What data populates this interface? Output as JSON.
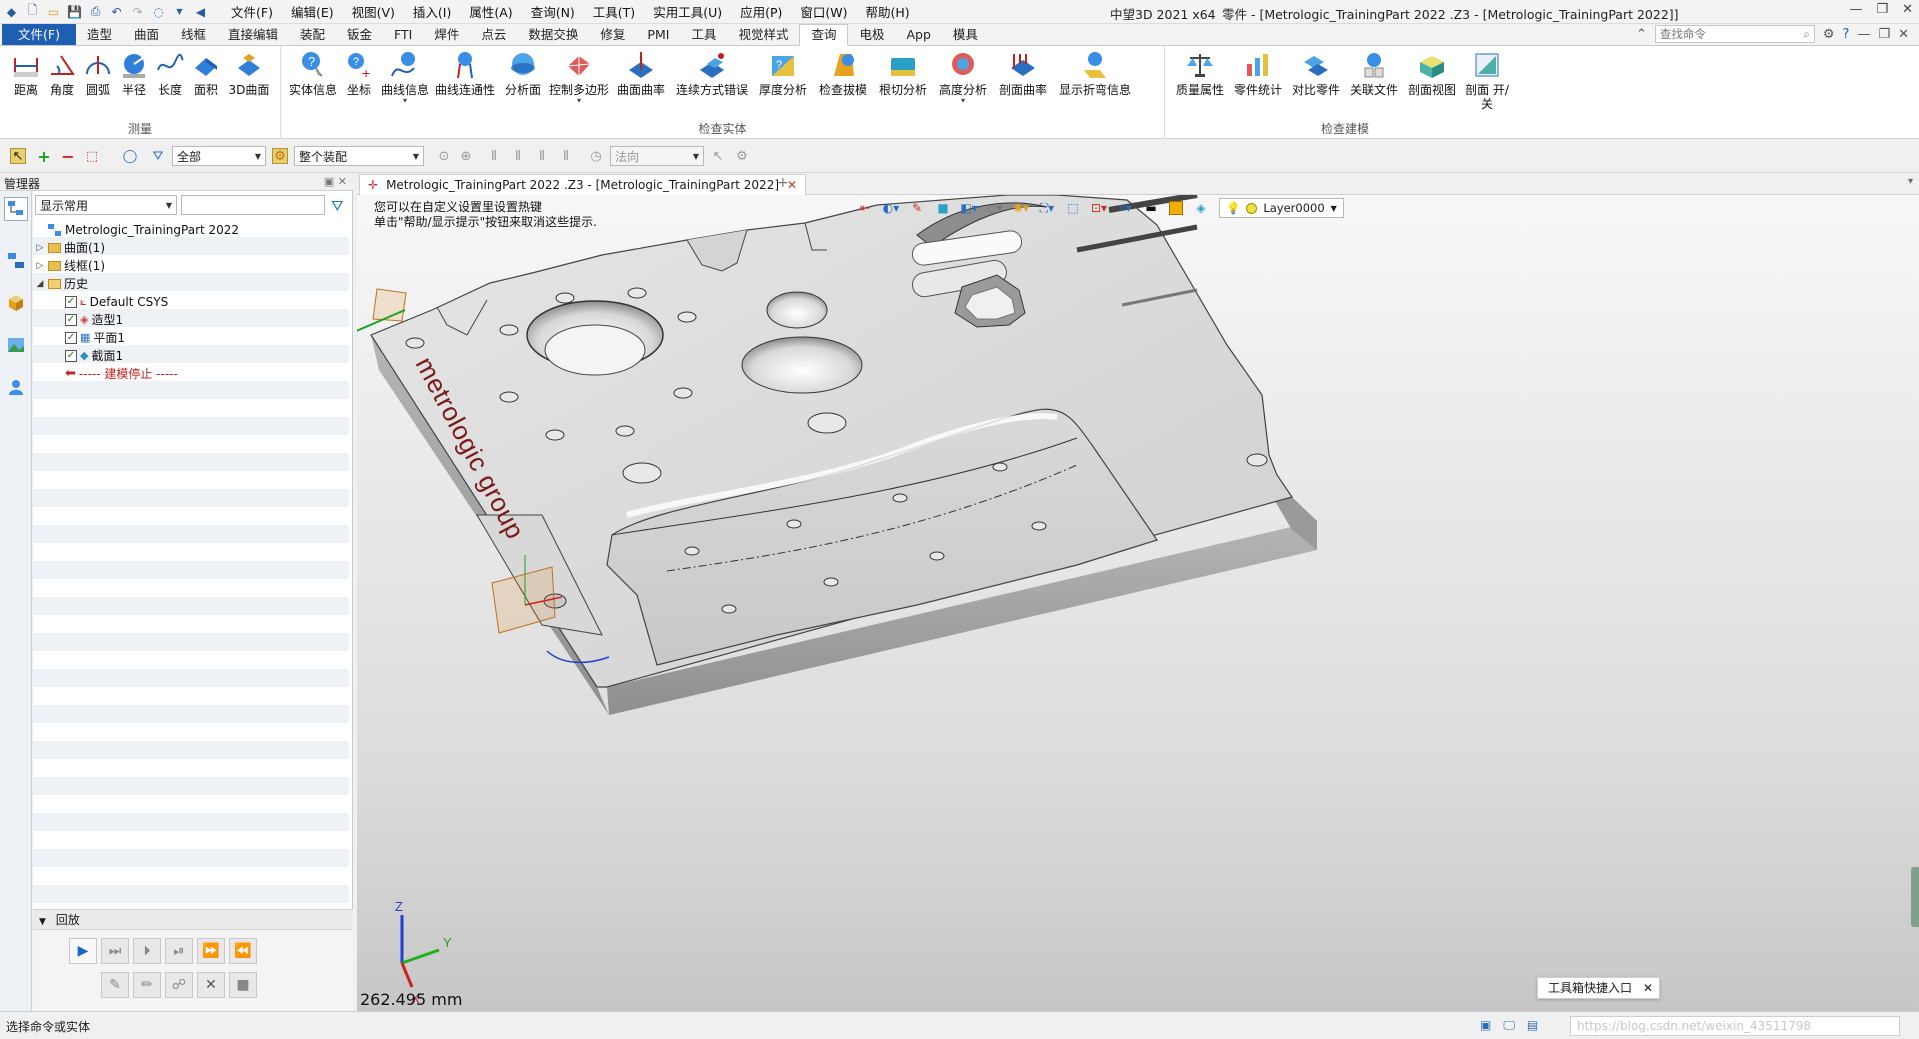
{
  "titlebar": {
    "menus": [
      "文件(F)",
      "编辑(E)",
      "视图(V)",
      "插入(I)",
      "属性(A)",
      "查询(N)",
      "工具(T)",
      "实用工具(U)",
      "应用(P)",
      "窗口(W)",
      "帮助(H)"
    ],
    "app_name": "中望3D 2021 x64",
    "doc_title": "零件 - [Metrologic_TrainingPart  2022 .Z3 - [Metrologic_TrainingPart  2022]]"
  },
  "ribbon_tabs": [
    "文件(F)",
    "造型",
    "曲面",
    "线框",
    "直接编辑",
    "装配",
    "钣金",
    "FTI",
    "焊件",
    "点云",
    "数据交换",
    "修复",
    "PMI",
    "工具",
    "视觉样式",
    "查询",
    "电极",
    "App",
    "模具"
  ],
  "active_tab": "查询",
  "command_search": {
    "placeholder": "查找命令"
  },
  "ribbon": {
    "measure": {
      "name": "测量",
      "buttons": [
        "距离",
        "角度",
        "圆弧",
        "半径",
        "长度",
        "面积",
        "3D曲面"
      ]
    },
    "inspect_entity": {
      "name": "检查实体",
      "buttons": [
        "实体信息",
        "坐标",
        "曲线信息",
        "曲线连通性",
        "分析面",
        "控制多边形",
        "曲面曲率",
        "连续方式错误",
        "厚度分析",
        "检查拔模",
        "根切分析",
        "高度分析",
        "剖面曲率",
        "显示折弯信息"
      ]
    },
    "inspect_model": {
      "name": "检查建模",
      "buttons": [
        "质量属性",
        "零件统计",
        "对比零件",
        "关联文件",
        "剖面视图",
        "剖面 开/关"
      ]
    }
  },
  "filterbar": {
    "filter_value": "全部",
    "assembly_value": "整个装配",
    "direction_value": "法向"
  },
  "manager": {
    "title": "管理器",
    "display_mode": "显示常用",
    "tree": {
      "root": "Metrologic_TrainingPart  2022",
      "surfaces": "曲面(1)",
      "wireframe": "线框(1)",
      "history": "历史",
      "items": [
        "Default CSYS",
        "造型1",
        "平面1",
        "截面1"
      ],
      "stop": "----- 建模停止 -----"
    },
    "playback_title": "回放"
  },
  "viewport": {
    "doc_tab": "Metrologic_TrainingPart  2022 .Z3 - [Metrologic_TrainingPart  2022]",
    "hint_line1": "您可以在自定义设置里设置热键",
    "hint_line2": "单击\"帮助/显示提示\"按钮来取消这些提示.",
    "layer": "Layer0000",
    "scale": "262.495 mm",
    "logo_text": "metrologic group",
    "axis_labels": {
      "x": "X",
      "y": "Y",
      "z": "Z"
    },
    "shortcut_popup": "工具箱快捷入口"
  },
  "statusbar": {
    "text": "选择命令或实体",
    "watermark": "https://blog.csdn.net/weixin_43511798"
  },
  "colors": {
    "file_tab": "#1e5fb4",
    "logo": "#7a1a1a",
    "axis_x": "#d02020",
    "axis_y": "#20a020",
    "axis_z": "#2040d0"
  }
}
